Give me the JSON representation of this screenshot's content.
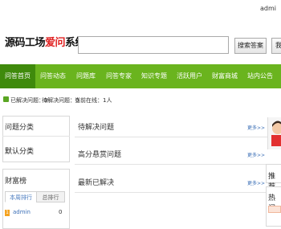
{
  "topbar": {
    "login": "admi"
  },
  "logo": {
    "part1": "源码工场",
    "part2": "爱问",
    "part3": "系统"
  },
  "search": {
    "value": "",
    "button": "搜索答案",
    "ask_button": "我"
  },
  "nav": {
    "items": [
      "问答首页",
      "问答动态",
      "问题库",
      "问答专家",
      "知识专题",
      "活跃用户",
      "财富商城",
      "站内公告"
    ]
  },
  "stats": {
    "resolved": "已解决问题：0",
    "pending": "待解决问题：0",
    "online": "当前在线：1人"
  },
  "sidebar": {
    "category_title": "问题分类",
    "category_default": "默认分类",
    "wealth_title": "财富榜",
    "tabs": [
      "本周排行",
      "总排行"
    ],
    "rank": [
      {
        "num": "1",
        "name": "admin",
        "value": "0"
      }
    ]
  },
  "main": {
    "sections": [
      {
        "title": "待解决问题",
        "more": "更多>>"
      },
      {
        "title": "高分悬赏问题",
        "more": "更多>>"
      },
      {
        "title": "最新已解决",
        "more": "更多>>"
      }
    ]
  },
  "right": {
    "recommend": "推荐",
    "hot": "热门"
  },
  "colors": {
    "nav": "#6ab41e",
    "nav_active": "#3f8a0c",
    "accent": "#e02020",
    "link": "#3b6fb6"
  }
}
